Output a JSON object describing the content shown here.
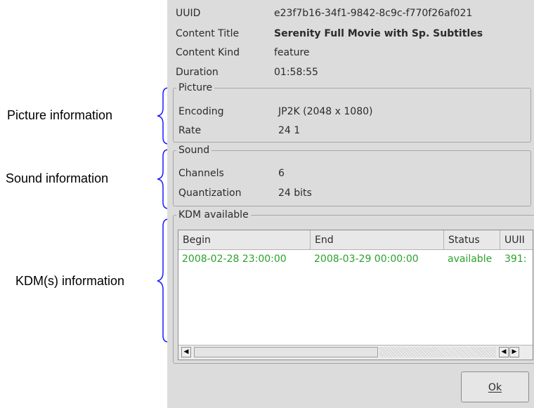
{
  "annotations": {
    "picture": "Picture information",
    "sound": "Sound information",
    "kdm": "KDM(s) information",
    "bracket_color": "#1a1aff"
  },
  "info": {
    "uuid_label": "UUID",
    "uuid_value": "e23f7b16-34f1-9842-8c9c-f770f26af021",
    "title_label": "Content Title",
    "title_value": "Serenity Full Movie with Sp. Subtitles",
    "kind_label": "Content Kind",
    "kind_value": "feature",
    "duration_label": "Duration",
    "duration_value": "01:58:55"
  },
  "picture": {
    "legend": "Picture",
    "encoding_label": "Encoding",
    "encoding_value": "JP2K (2048 x 1080)",
    "rate_label": "Rate",
    "rate_value": "24 1"
  },
  "sound": {
    "legend": "Sound",
    "channels_label": "Channels",
    "channels_value": "6",
    "quantization_label": "Quantization",
    "quantization_value": "24 bits"
  },
  "kdm": {
    "legend": "KDM available",
    "columns": [
      "Begin",
      "End",
      "Status",
      "UUII"
    ],
    "rows": [
      {
        "begin": "2008-02-28 23:00:00",
        "end": "2008-03-29 00:00:00",
        "status": "available",
        "uuid": "391:"
      }
    ],
    "row_color": "#2aa22a"
  },
  "buttons": {
    "ok": "Ok"
  }
}
